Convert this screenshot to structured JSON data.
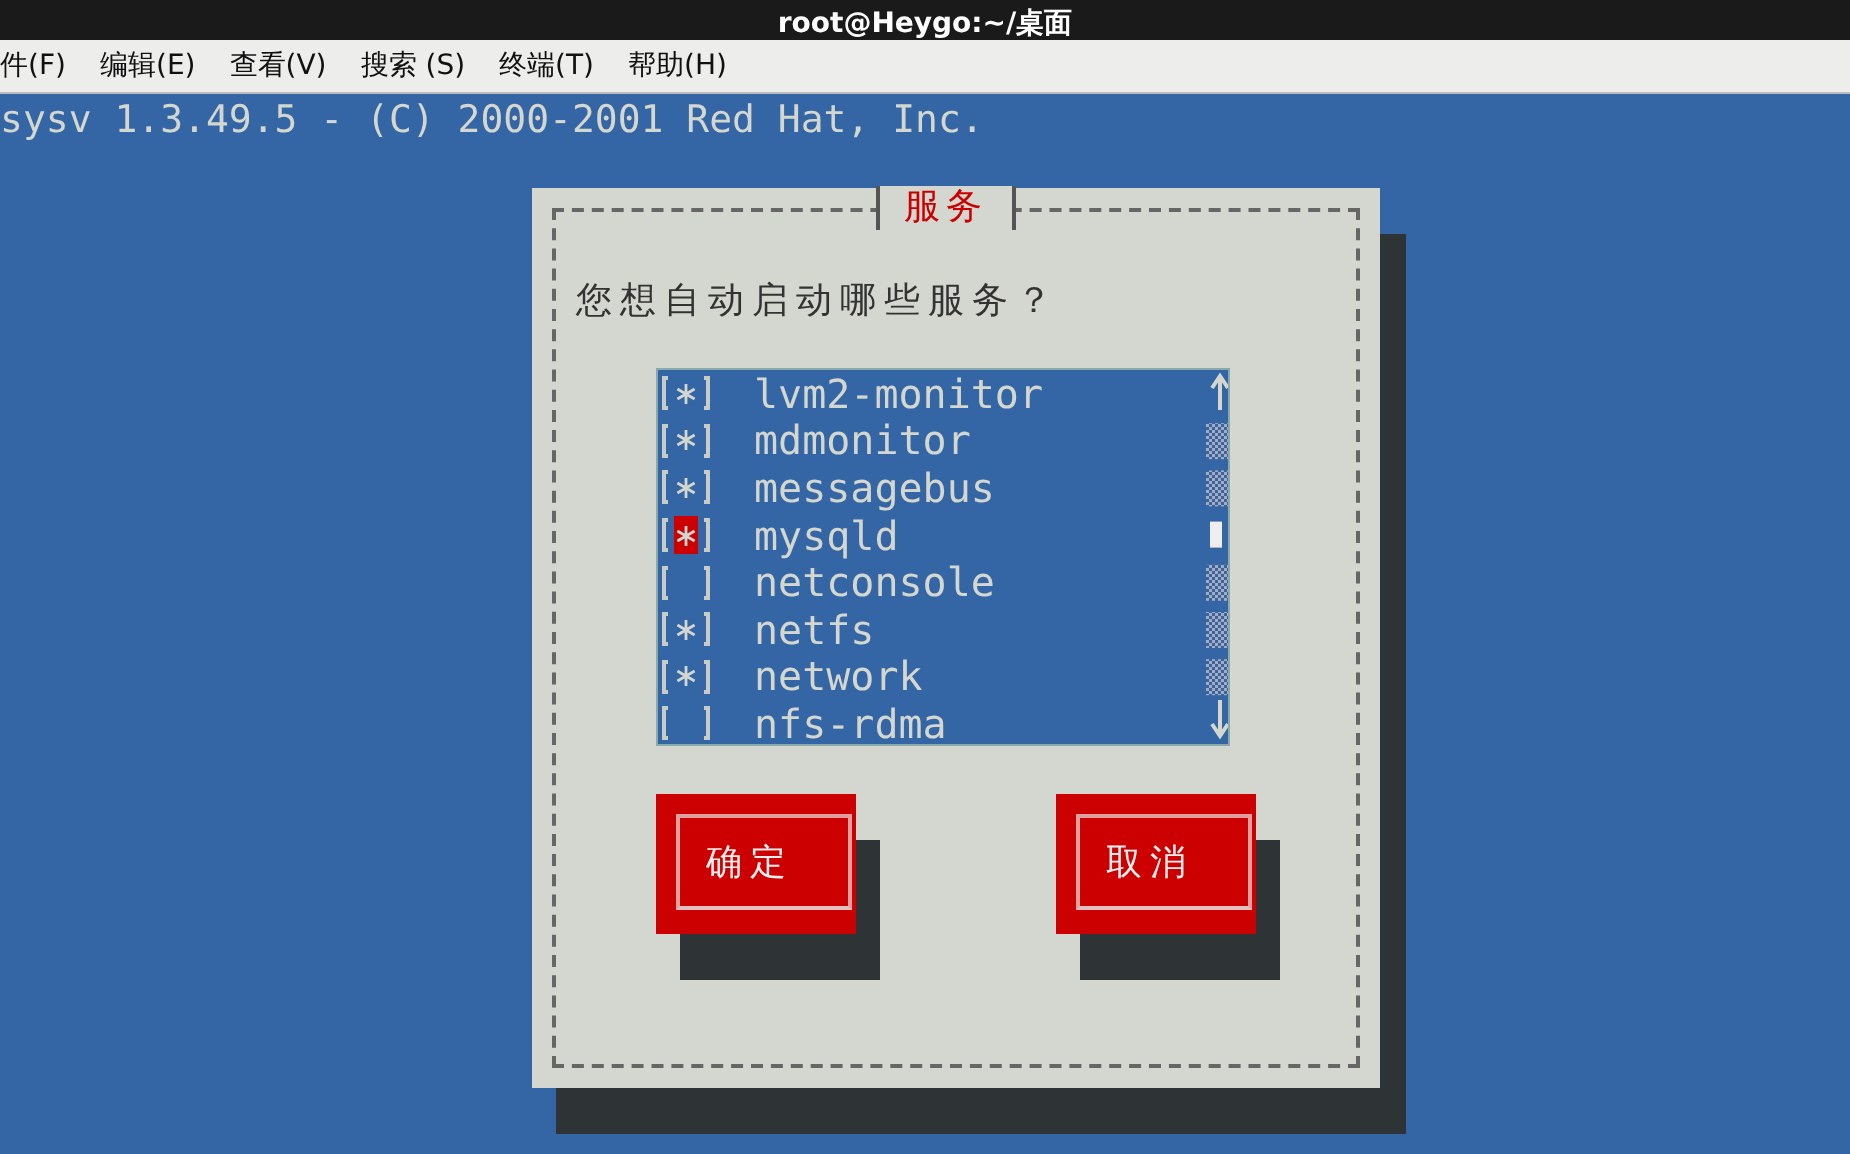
{
  "window": {
    "title": "root@Heygo:~/桌面"
  },
  "menu": [
    "件(F)",
    "编辑(E)",
    "查看(V)",
    "搜索 (S)",
    "终端(T)",
    "帮助(H)"
  ],
  "terminal_line": "sysv 1.3.49.5 - (C) 2000-2001 Red Hat, Inc.",
  "dialog": {
    "title": "服务",
    "question": "您想自动启动哪些服务？",
    "services": [
      {
        "name": "lvm2-monitor",
        "checked": true,
        "focused": false
      },
      {
        "name": "mdmonitor",
        "checked": true,
        "focused": false
      },
      {
        "name": "messagebus",
        "checked": true,
        "focused": false
      },
      {
        "name": "mysqld",
        "checked": true,
        "focused": true
      },
      {
        "name": "netconsole",
        "checked": false,
        "focused": false
      },
      {
        "name": "netfs",
        "checked": true,
        "focused": false
      },
      {
        "name": "network",
        "checked": true,
        "focused": false
      },
      {
        "name": "nfs-rdma",
        "checked": false,
        "focused": false
      }
    ],
    "buttons": [
      "确定",
      "取消"
    ]
  }
}
